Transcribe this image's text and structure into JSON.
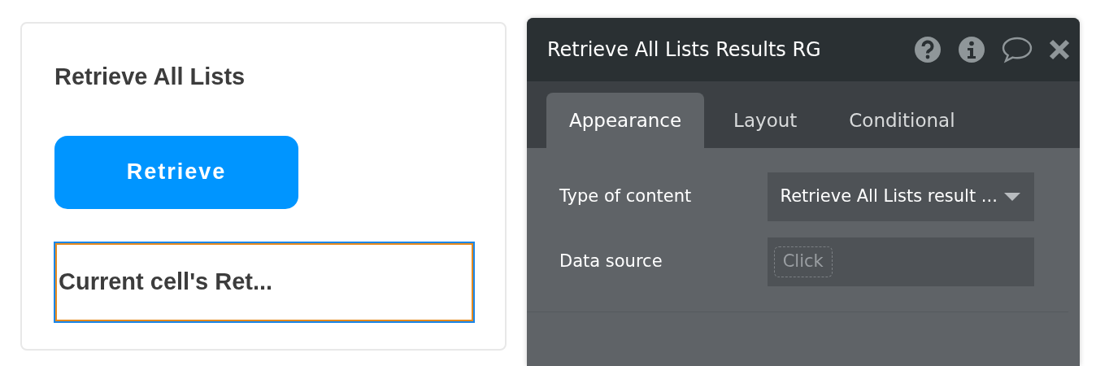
{
  "canvas": {
    "title": "Retrieve All Lists",
    "button": "Retrieve",
    "cell": {
      "text": "Current cell's Ret...",
      "selected": true
    }
  },
  "panel": {
    "title": "Retrieve All Lists Results RG",
    "tabs": [
      {
        "label": "Appearance",
        "selected": true
      },
      {
        "label": "Layout",
        "selected": false
      },
      {
        "label": "Conditional",
        "selected": false
      }
    ],
    "fields": [
      {
        "label": "Type of content",
        "kind": "dropdown",
        "value": "Retrieve All Lists result ..."
      },
      {
        "label": "Data source",
        "kind": "expression",
        "placeholder": "Click"
      }
    ]
  }
}
